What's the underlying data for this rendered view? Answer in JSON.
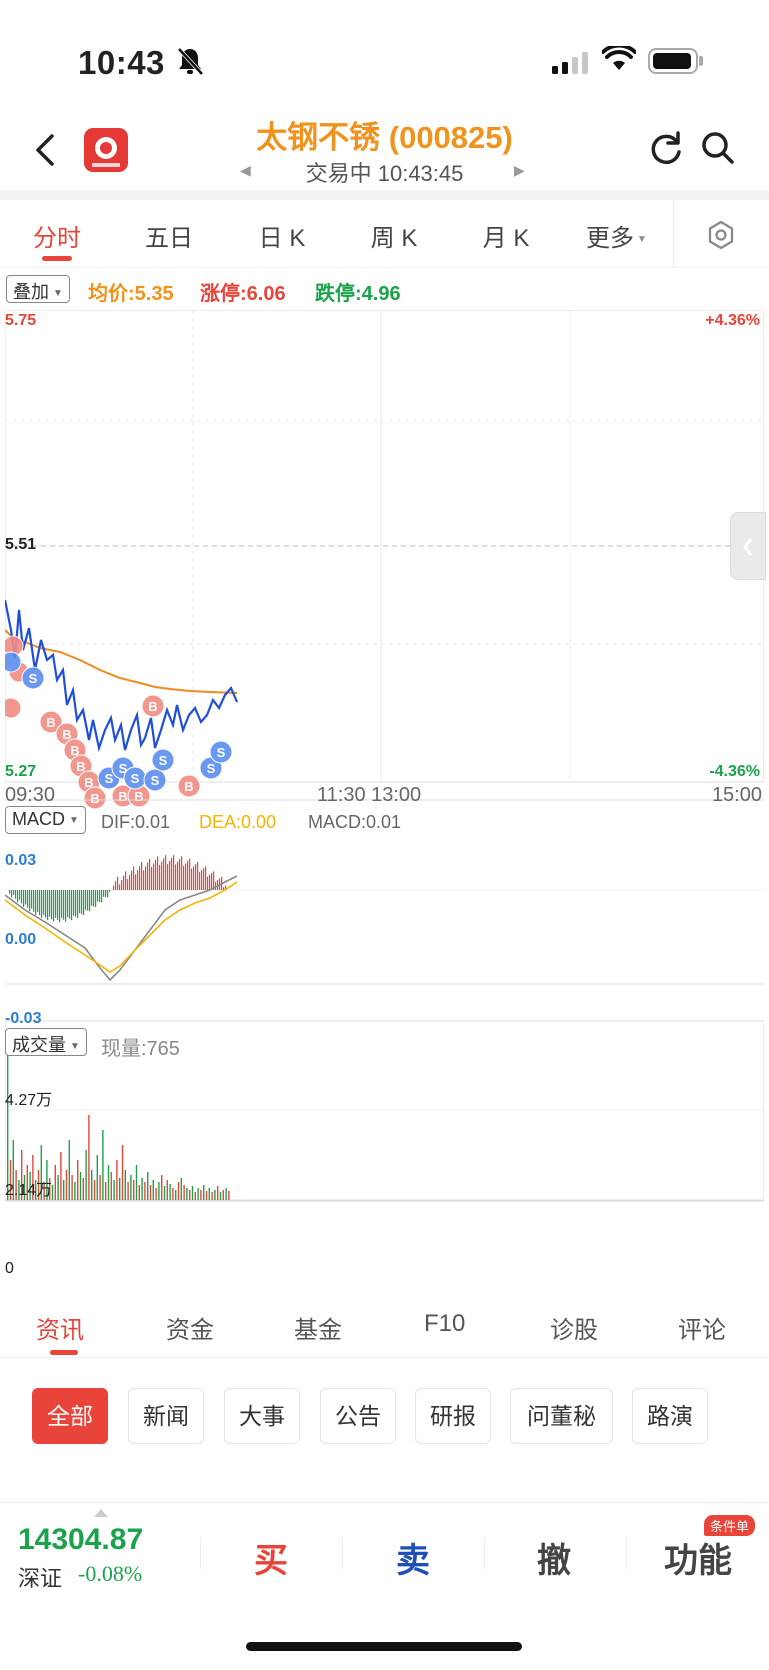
{
  "status_bar": {
    "time": "10:43"
  },
  "header": {
    "title": "太钢不锈 (000825)",
    "subtitle": "交易中 10:43:45"
  },
  "period_tabs": [
    {
      "label": "分时",
      "active": true
    },
    {
      "label": "五日"
    },
    {
      "label": "日 K"
    },
    {
      "label": "周 K"
    },
    {
      "label": "月 K"
    },
    {
      "label": "更多"
    }
  ],
  "overlay": {
    "dropdown": "叠加",
    "avg_price": "均价:5.35",
    "limit_up": "涨停:6.06",
    "limit_down": "跌停:4.96"
  },
  "price_chart": {
    "y_top": "5.75",
    "y_mid": "5.51",
    "y_bottom": "5.27",
    "pct_top": "+4.36%",
    "pct_bottom": "-4.36%",
    "x_labels": [
      "09:30",
      "11:30 13:00",
      "15:00"
    ]
  },
  "macd": {
    "dropdown": "MACD",
    "dif": "DIF:0.01",
    "dea": "DEA:0.00",
    "macd": "MACD:0.01",
    "y_top": "0.03",
    "y_mid": "0.00",
    "y_bottom": "-0.03"
  },
  "volume": {
    "dropdown": "成交量",
    "current": "现量:765",
    "y_top": "4.27万",
    "y_mid": "2.14万",
    "y_bottom": "0"
  },
  "info_tabs": [
    {
      "label": "资讯",
      "active": true
    },
    {
      "label": "资金"
    },
    {
      "label": "基金"
    },
    {
      "label": "F10"
    },
    {
      "label": "诊股"
    },
    {
      "label": "评论"
    }
  ],
  "chips": [
    {
      "label": "全部",
      "active": true
    },
    {
      "label": "新闻"
    },
    {
      "label": "大事"
    },
    {
      "label": "公告"
    },
    {
      "label": "研报"
    },
    {
      "label": "问董秘"
    },
    {
      "label": "路演"
    }
  ],
  "trade_bar": {
    "index_value": "14304.87",
    "index_name": "深证",
    "index_change": "-0.08%",
    "buy": "买",
    "sell": "卖",
    "cancel": "撤",
    "function": "功能",
    "badge": "条件单"
  },
  "colors": {
    "up": "#e8443a",
    "down": "#1aa34a",
    "price_line": "#1f4fd8",
    "avg_line": "#f08a1e",
    "title": "#f0921b"
  }
}
